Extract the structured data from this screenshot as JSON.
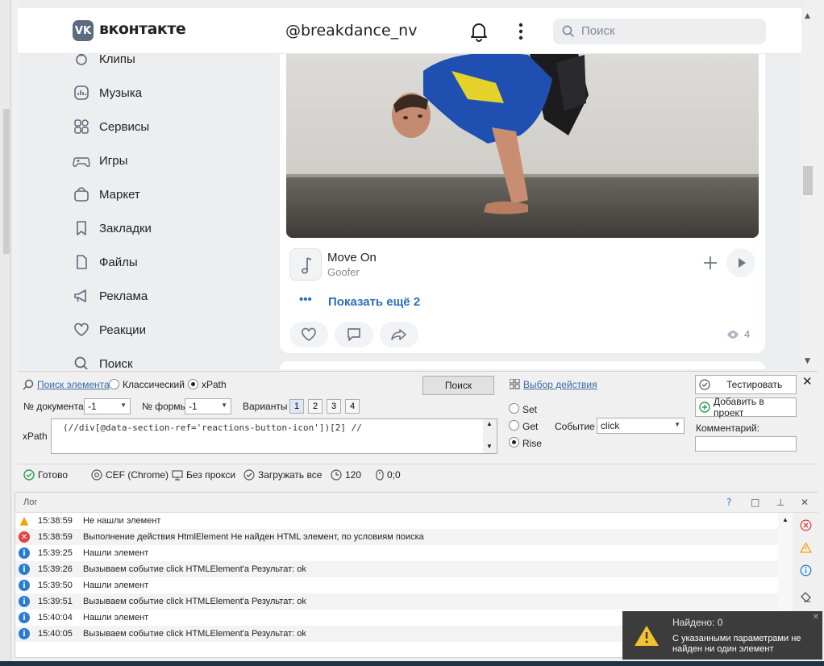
{
  "vk": {
    "logo_letters": "VK",
    "brand": "вконтакте",
    "username": "@breakdance_nv",
    "search_placeholder": "Поиск"
  },
  "sidebar": {
    "items": [
      {
        "label": "Клипы",
        "icon": "clips-icon"
      },
      {
        "label": "Музыка",
        "icon": "music-icon"
      },
      {
        "label": "Сервисы",
        "icon": "services-icon"
      },
      {
        "label": "Игры",
        "icon": "gamepad-icon"
      },
      {
        "label": "Маркет",
        "icon": "market-bag-icon"
      },
      {
        "label": "Закладки",
        "icon": "bookmark-icon"
      },
      {
        "label": "Файлы",
        "icon": "file-icon"
      },
      {
        "label": "Реклама",
        "icon": "megaphone-icon"
      },
      {
        "label": "Реакции",
        "icon": "heart-icon"
      },
      {
        "label": "Поиск",
        "icon": "search-icon"
      }
    ]
  },
  "post": {
    "track_title": "Move On",
    "track_artist": "Goofer",
    "show_more_dots": "•••",
    "show_more": "Показать ещё 2",
    "views": "4"
  },
  "search_panel": {
    "find_element": "Поиск элемента",
    "classic": "Классический",
    "xpath_mode": "xPath",
    "search_button": "Поиск",
    "choose_action": "Выбор действия",
    "test_button": "Тестировать",
    "add_button": "Добавить в проект",
    "doc_label": "№ документа",
    "doc_value": "-1",
    "form_label": "№ формы",
    "form_value": "-1",
    "variants_label": "Варианты",
    "variants": [
      "1",
      "2",
      "3",
      "4"
    ],
    "xpath_label": "xPath",
    "xpath_value": "(//div[@data-section-ref='reactions-button-icon'])[2] //",
    "set": "Set",
    "get": "Get",
    "rise": "Rise",
    "event_label": "Событие",
    "event_value": "click",
    "comment_label": "Комментарий:"
  },
  "status": {
    "ready": "Готово",
    "engine": "CEF (Chrome)",
    "proxy": "Без прокси",
    "load_all": "Загружать все",
    "timeout": "120",
    "coords": "0;0"
  },
  "log": {
    "title": "Лог",
    "help": "?",
    "rows": [
      {
        "type": "warning",
        "time": "15:38:59",
        "msg": "Не нашли элемент"
      },
      {
        "type": "error",
        "time": "15:38:59",
        "msg": "Выполнение действия HtmlElement Не найден HTML элемент, по условиям поиска"
      },
      {
        "type": "info",
        "time": "15:39:25",
        "msg": "Нашли элемент"
      },
      {
        "type": "info",
        "time": "15:39:26",
        "msg": "Вызываем событие click HTMLElement'a  Результат: ok"
      },
      {
        "type": "info",
        "time": "15:39:50",
        "msg": "Нашли элемент"
      },
      {
        "type": "info",
        "time": "15:39:51",
        "msg": "Вызываем событие click HTMLElement'a  Результат: ok"
      },
      {
        "type": "info",
        "time": "15:40:04",
        "msg": "Нашли элемент"
      },
      {
        "type": "info",
        "time": "15:40:05",
        "msg": "Вызываем событие click HTMLElement'a  Результат: ok"
      }
    ]
  },
  "toast": {
    "title": "Найдено: 0",
    "body": "С указанными параметрами не найден ни один элемент"
  },
  "colors": {
    "accent": "#2a6fb8",
    "warning": "#f2a20c",
    "error": "#e04444",
    "info": "#2b7bd9",
    "ok": "#2f9e4f"
  }
}
